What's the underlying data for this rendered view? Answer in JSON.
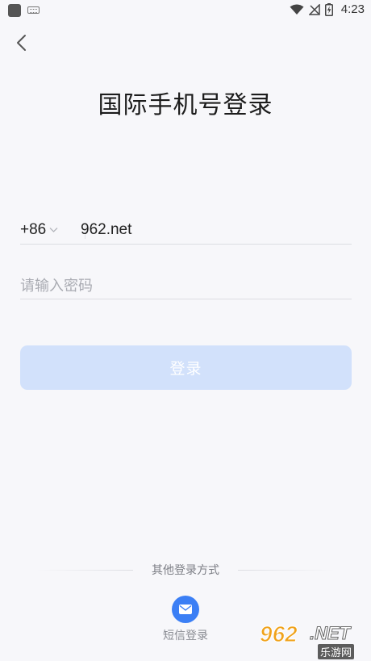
{
  "status_bar": {
    "time": "4:23",
    "icons": [
      "app-icon",
      "keyboard-icon",
      "wifi-icon",
      "no-signal-icon",
      "battery-charging-icon"
    ]
  },
  "header": {
    "back_icon": "chevron-left-icon",
    "title": "国际手机号登录"
  },
  "form": {
    "country_code": "+86",
    "phone_value": "962.net",
    "password_placeholder": "请输入密码",
    "login_label": "登录"
  },
  "other_login": {
    "label": "其他登录方式",
    "sms_label": "短信登录",
    "sms_icon": "message-icon"
  },
  "watermark": {
    "brand_number": "962",
    "brand_suffix": ".NET",
    "brand_sub": "乐游网"
  },
  "colors": {
    "background": "#f7f7fa",
    "login_button_disabled": "#d2e1fb",
    "accent": "#3b7ff5",
    "divider": "#dcdde2",
    "placeholder": "#a9abb2"
  }
}
